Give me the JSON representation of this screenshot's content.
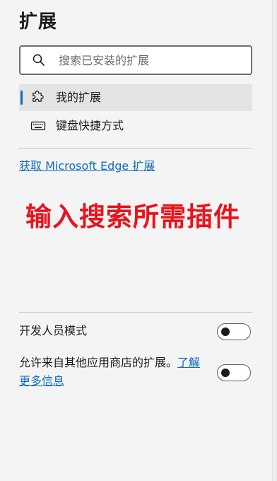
{
  "header": {
    "title": "扩展"
  },
  "search": {
    "placeholder": "搜索已安装的扩展",
    "value": "",
    "icon": "search-icon"
  },
  "nav": {
    "items": [
      {
        "label": "我的扩展",
        "icon": "puzzle-piece-icon",
        "active": true
      },
      {
        "label": "键盘快捷方式",
        "icon": "keyboard-icon",
        "active": false
      }
    ]
  },
  "store_link": "获取 Microsoft Edge 扩展",
  "annotation": "输入搜索所需插件",
  "settings": {
    "developer_mode": {
      "label": "开发人员模式",
      "enabled": false
    },
    "allow_other_stores": {
      "label": "允许来自其他应用商店的扩展。",
      "link": "了解更多信息",
      "enabled": false
    }
  },
  "colors": {
    "accent": "#0f6cbd",
    "annotation": "#e8141b",
    "background": "#f4f4f4"
  }
}
